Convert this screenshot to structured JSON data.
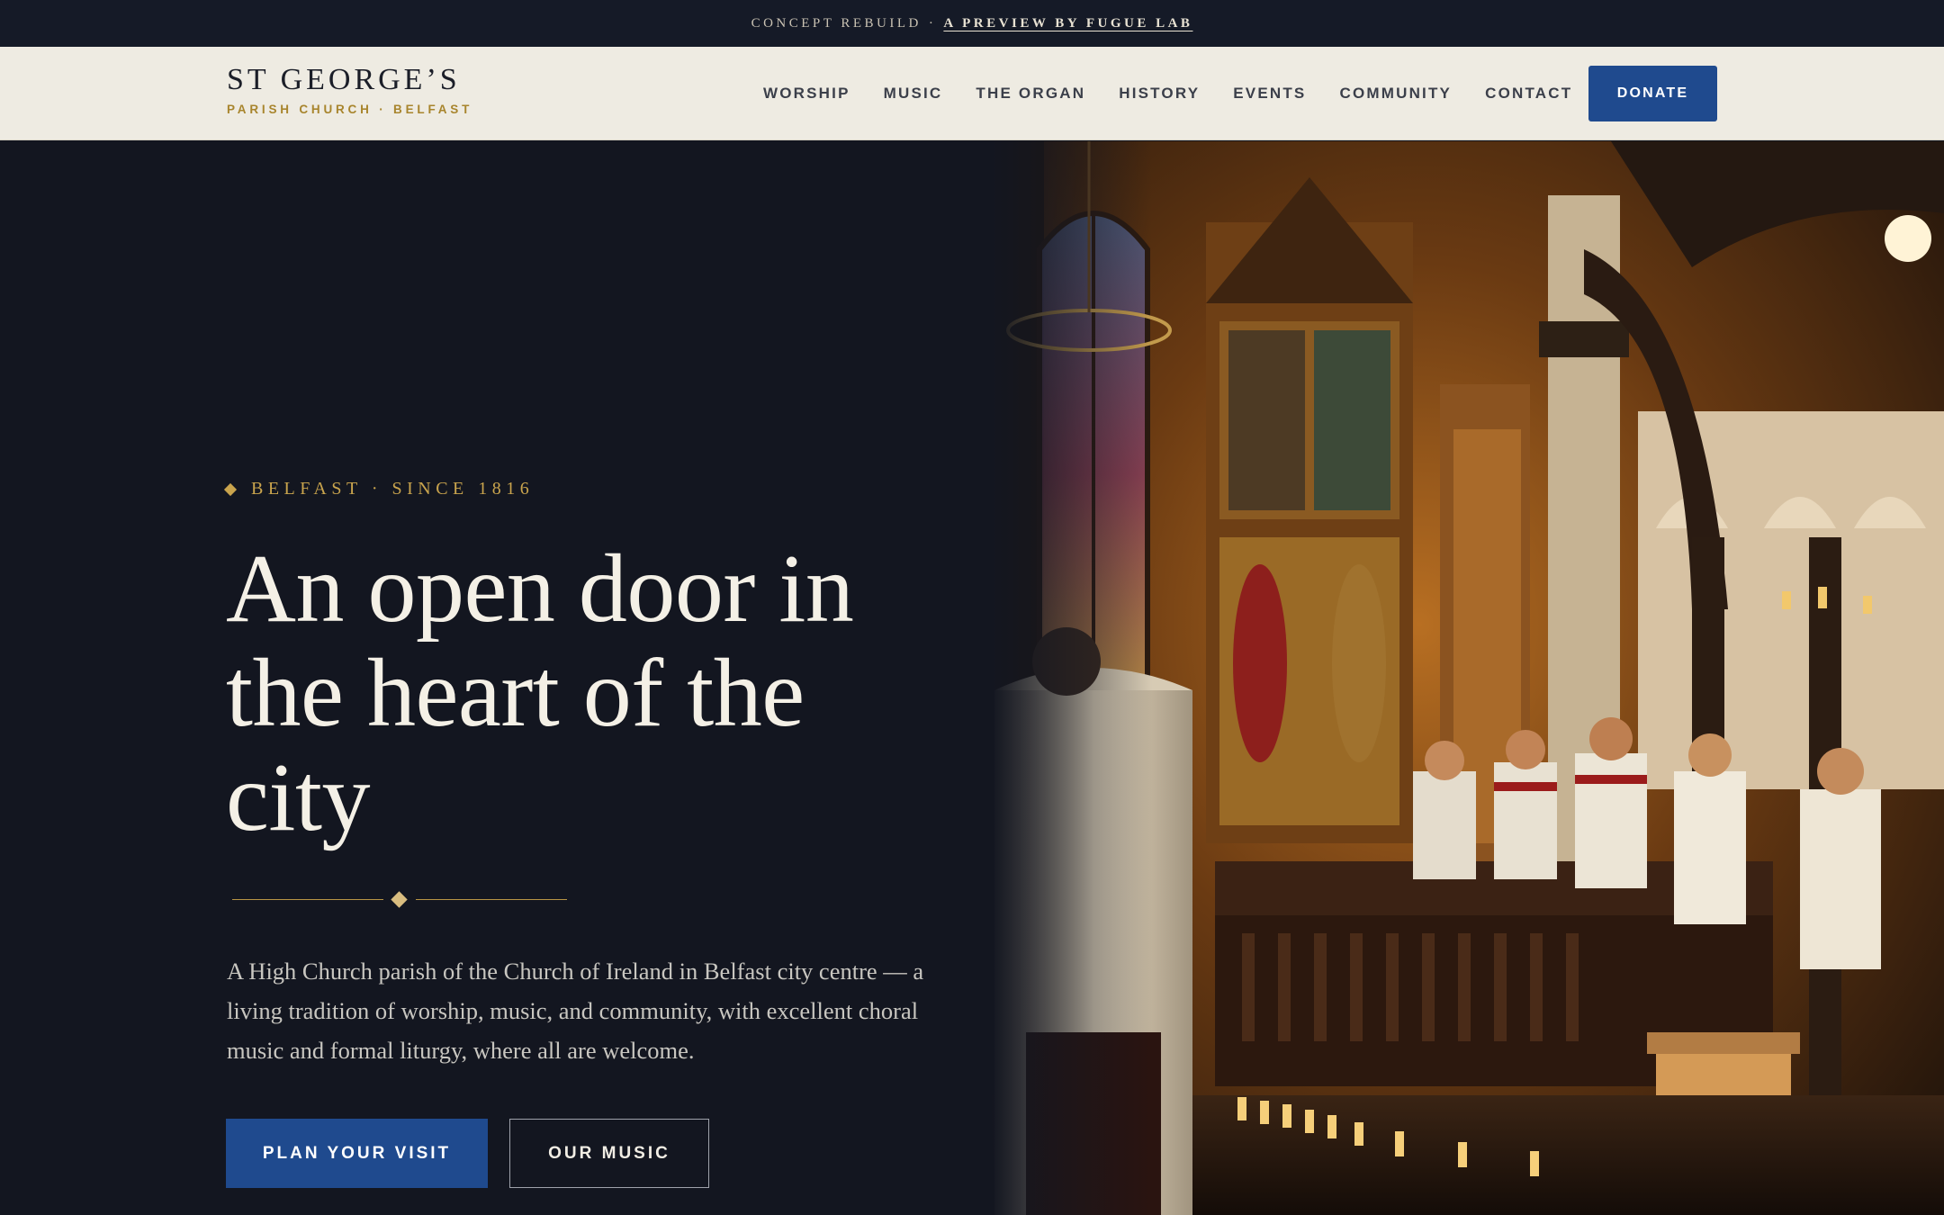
{
  "topbar": {
    "concept_label": "CONCEPT REBUILD",
    "separator": "·",
    "preview_link": "A PREVIEW BY FUGUE LAB"
  },
  "header": {
    "brand_name": "ST GEORGE’S",
    "brand_sub": "PARISH CHURCH · BELFAST",
    "nav": [
      "WORSHIP",
      "MUSIC",
      "THE ORGAN",
      "HISTORY",
      "EVENTS",
      "COMMUNITY",
      "CONTACT"
    ],
    "donate_label": "DONATE"
  },
  "hero": {
    "eyebrow": "BELFAST · SINCE 1816",
    "headline": "An open door in the heart of the city",
    "lede": "A High Church parish of the Church of Ireland in Belfast city centre — a living tradition of worship, music, and community, with excellent choral music and formal liturgy, where all are welcome.",
    "primary_cta": "PLAN YOUR VISIT",
    "secondary_cta": "OUR MUSIC",
    "photo_icon": "choir-interior-photo"
  },
  "colors": {
    "navy_bg": "#131620",
    "topbar_bg": "#151a27",
    "header_bg": "#eeebe2",
    "accent_blue": "#1f4a8e",
    "gold": "#c9a44d",
    "headline_text": "#f4f0e6"
  }
}
